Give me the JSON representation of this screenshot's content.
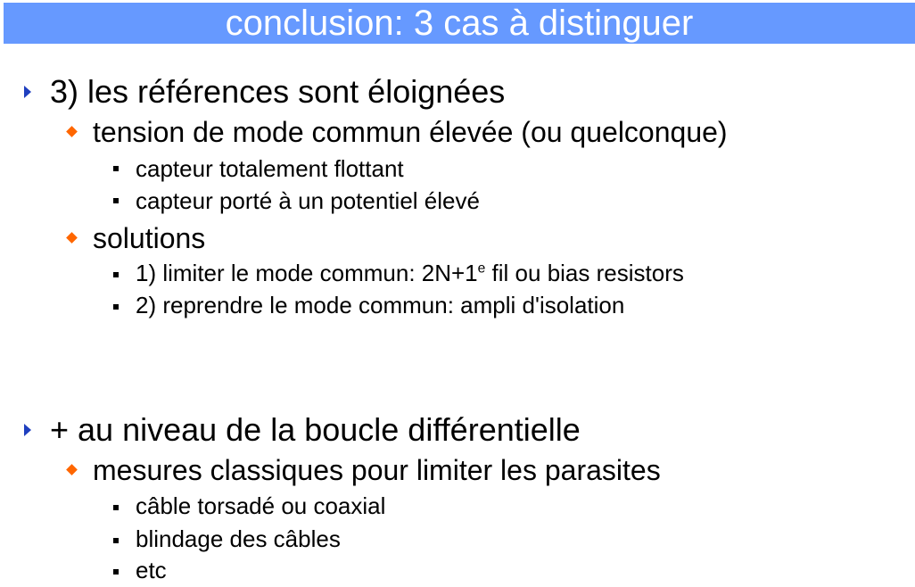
{
  "slide": {
    "title": "conclusion: 3 cas à distinguer",
    "section1": {
      "heading": "3) les références sont éloignées",
      "sub1": {
        "label": "tension de mode commun élevée (ou quelconque)",
        "items": [
          "capteur totalement flottant",
          "capteur porté à un potentiel élevé"
        ]
      },
      "sub2": {
        "label": "solutions",
        "item1_pre": "1) limiter le mode commun: 2N+1",
        "item1_sup": "e",
        "item1_post": " fil ou bias resistors",
        "item2": "2) reprendre le mode commun: ampli d'isolation"
      }
    },
    "section2": {
      "heading": "+ au niveau de la boucle différentielle",
      "sub1": {
        "label": "mesures classiques pour limiter les parasites",
        "items": [
          "câble torsadé ou coaxial",
          "blindage des câbles",
          "etc"
        ]
      }
    }
  },
  "colors": {
    "title_bar": "#6699ff",
    "title_text": "#ffffff",
    "level1_bullet": "#1f3fbf",
    "level2_bullet": "#ff6600",
    "level3_bullet": "#000000"
  },
  "icons": {
    "level1": "triangle-bullet-icon",
    "level2": "diamond-bullet-icon",
    "level3": "square-bullet-icon"
  }
}
